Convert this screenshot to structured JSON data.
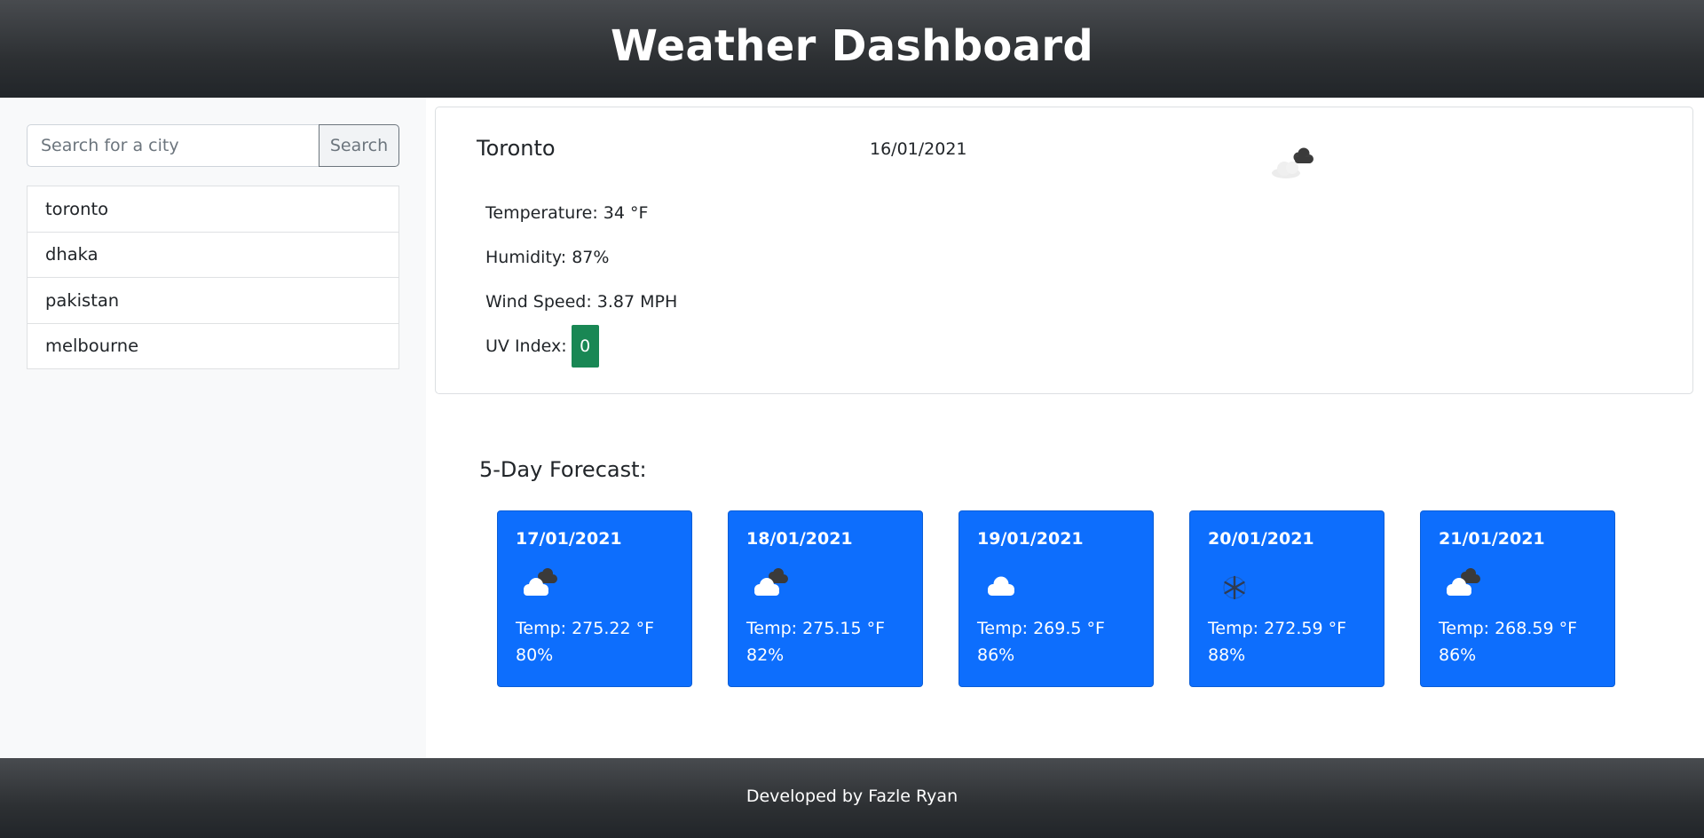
{
  "header": {
    "title": "Weather Dashboard"
  },
  "sidebar": {
    "search": {
      "placeholder": "Search for a city",
      "value": "",
      "button_label": "Search"
    },
    "history": [
      "toronto",
      "dhaka",
      "pakistan",
      "melbourne"
    ]
  },
  "current": {
    "city": "Toronto",
    "date": "16/01/2021",
    "icon": "cloudy-dark-icon",
    "temperature": "Temperature: 34 °F",
    "humidity": "Humidity: 87%",
    "wind_speed": "Wind Speed: 3.87 MPH",
    "uv_label": "UV Index:",
    "uv_value": "0",
    "uv_color": "#198754"
  },
  "forecast": {
    "title": "5-Day Forecast:",
    "card_color": "#0d6efd",
    "days": [
      {
        "date": "17/01/2021",
        "icon": "broken-clouds-icon",
        "temp": "Temp: 275.22 °F",
        "humidity": "80%"
      },
      {
        "date": "18/01/2021",
        "icon": "broken-clouds-icon",
        "temp": "Temp: 275.15 °F",
        "humidity": "82%"
      },
      {
        "date": "19/01/2021",
        "icon": "cloud-icon",
        "temp": "Temp: 269.5 °F",
        "humidity": "86%"
      },
      {
        "date": "20/01/2021",
        "icon": "snowflake-icon",
        "temp": "Temp: 272.59 °F",
        "humidity": "88%"
      },
      {
        "date": "21/01/2021",
        "icon": "broken-clouds-icon",
        "temp": "Temp: 268.59 °F",
        "humidity": "86%"
      }
    ]
  },
  "footer": {
    "text": "Developed by Fazle Ryan"
  }
}
